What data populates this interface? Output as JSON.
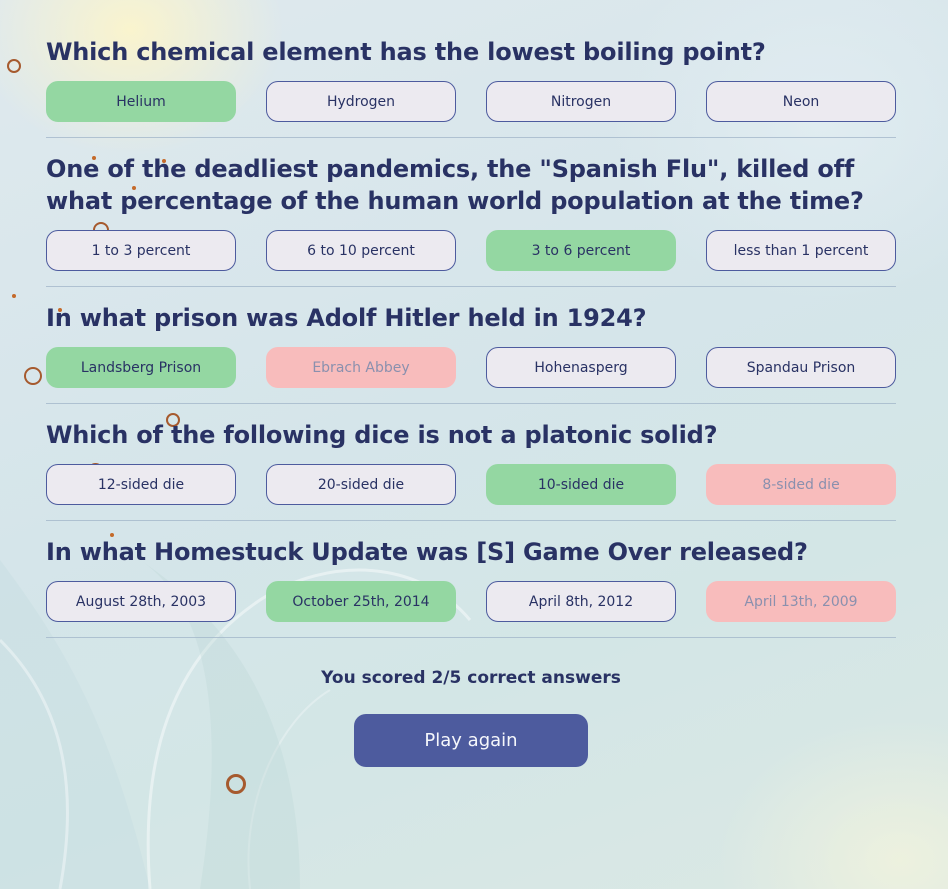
{
  "questions": [
    {
      "text": "Which chemical element has the lowest boiling point?",
      "answers": [
        {
          "label": "Helium",
          "state": "correct"
        },
        {
          "label": "Hydrogen",
          "state": "neutral"
        },
        {
          "label": "Nitrogen",
          "state": "neutral"
        },
        {
          "label": "Neon",
          "state": "neutral"
        }
      ]
    },
    {
      "text": "One of the deadliest pandemics, the \"Spanish Flu\", killed off what percentage of the human world population at the time?",
      "answers": [
        {
          "label": "1 to 3 percent",
          "state": "neutral"
        },
        {
          "label": "6 to 10 percent",
          "state": "neutral"
        },
        {
          "label": "3 to 6 percent",
          "state": "correct"
        },
        {
          "label": "less than 1 percent",
          "state": "neutral"
        }
      ]
    },
    {
      "text": "In what prison was Adolf Hitler held in 1924?",
      "answers": [
        {
          "label": "Landsberg Prison",
          "state": "correct"
        },
        {
          "label": "Ebrach Abbey",
          "state": "wrong"
        },
        {
          "label": "Hohenasperg",
          "state": "neutral"
        },
        {
          "label": "Spandau Prison",
          "state": "neutral"
        }
      ]
    },
    {
      "text": "Which of the following dice is not a platonic solid?",
      "answers": [
        {
          "label": "12-sided die",
          "state": "neutral"
        },
        {
          "label": "20-sided die",
          "state": "neutral"
        },
        {
          "label": "10-sided die",
          "state": "correct"
        },
        {
          "label": "8-sided die",
          "state": "wrong"
        }
      ]
    },
    {
      "text": "In what Homestuck Update was [S] Game Over released?",
      "answers": [
        {
          "label": "August 28th, 2003",
          "state": "neutral"
        },
        {
          "label": "October 25th, 2014",
          "state": "correct"
        },
        {
          "label": "April 8th, 2012",
          "state": "neutral"
        },
        {
          "label": "April 13th, 2009",
          "state": "wrong"
        }
      ]
    }
  ],
  "result": {
    "score_text": "You scored 2/5 correct answers",
    "play_again_label": "Play again"
  },
  "colors": {
    "text": "#293264",
    "correct": "#94d7a2",
    "wrong": "#f8bcbc",
    "neutral": "#eceaf0",
    "accent": "#4d5b9e"
  }
}
